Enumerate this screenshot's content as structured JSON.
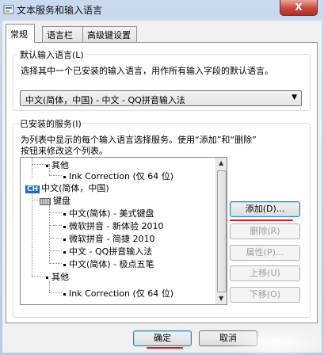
{
  "window": {
    "title": "文本服务和输入语言",
    "close_glyph": "X"
  },
  "tabs": [
    {
      "label": "常规",
      "active": true
    },
    {
      "label": "语言栏",
      "active": false
    },
    {
      "label": "高级键设置",
      "active": false
    }
  ],
  "default_language": {
    "group_title": "默认输入语言(L)",
    "description": "选择其中一个已安装的输入语言，用作所有输入字段的默认语言。",
    "selected_value": "中文(简体，中国) - 中文 - QQ拼音输入法"
  },
  "installed_services": {
    "group_title": "已安装的服务(I)",
    "description_line1": "为列表中显示的每个输入语言选择服务。使用“添加”和“删除”",
    "description_line2": "按钮来修改这个列表。",
    "tree": {
      "other_top": "其他",
      "ink_top": "Ink Correction (仅 64 位)",
      "lang_badge": "CH",
      "lang_name": "中文(简体，中国)",
      "keyboard_label": "键盘",
      "keyboards": [
        "中文(简体) - 美式键盘",
        "微软拼音 - 新体验 2010",
        "微软拼音 - 简捷 2010",
        "中文 - QQ拼音输入法",
        "中文(简体) - 极点五笔"
      ],
      "other_bottom": "其他",
      "ink_bottom": "Ink Correction (仅 64 位)"
    },
    "buttons": {
      "add": "添加(D)...",
      "remove": "删除(R)",
      "properties": "属性(P)...",
      "move_up": "上移(U)",
      "move_down": "下移(O)"
    }
  },
  "footer": {
    "ok": "确定",
    "cancel": "取消"
  },
  "colors": {
    "annotation_red": "#d81c1c",
    "lang_badge_blue": "#1e66c8"
  }
}
